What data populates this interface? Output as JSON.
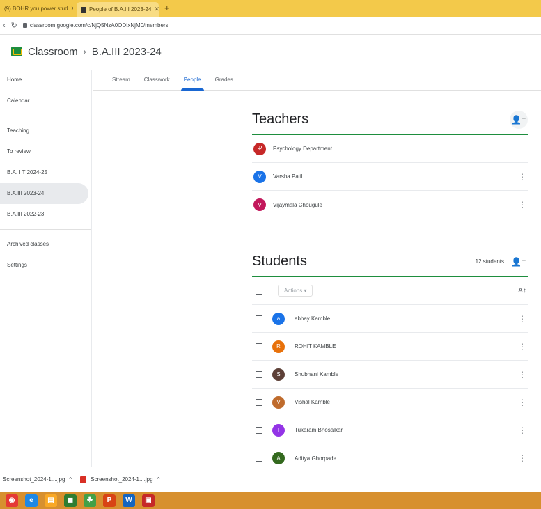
{
  "browser": {
    "tabs": [
      {
        "label": "(9) BOHR you power stud"
      },
      {
        "label": "People of B.A.III 2023-24"
      }
    ],
    "url": "classroom.google.com/c/NjQ5NzA0ODIxNjM0/members"
  },
  "header": {
    "app_title": "Classroom",
    "separator": "›",
    "class_title": "B.A.III 2023-24"
  },
  "sidebar": {
    "items": [
      {
        "label": "Home"
      },
      {
        "label": "Calendar"
      },
      {
        "label": "Teaching"
      },
      {
        "label": "To review"
      },
      {
        "label": "B.A. I T 2024-25"
      },
      {
        "label": "B.A.III 2023-24"
      },
      {
        "label": "B.A.III 2022-23"
      },
      {
        "label": "Archived classes"
      },
      {
        "label": "Settings"
      }
    ]
  },
  "class_tabs": [
    {
      "label": "Stream"
    },
    {
      "label": "Classwork"
    },
    {
      "label": "People"
    },
    {
      "label": "Grades"
    }
  ],
  "teachers": {
    "title": "Teachers",
    "list": [
      {
        "initial": "Ψ",
        "name": "Psychology Department",
        "color": "#c62828"
      },
      {
        "initial": "V",
        "name": "Varsha Patil",
        "color": "#1a73e8"
      },
      {
        "initial": "V",
        "name": "Vijaymala Chougule",
        "color": "#c2185b"
      }
    ]
  },
  "students": {
    "title": "Students",
    "count_label": "12 students",
    "actions_label": "Actions ▾",
    "list": [
      {
        "initial": "a",
        "name": "abhay Kamble",
        "color": "#1a73e8"
      },
      {
        "initial": "R",
        "name": "ROHIT KAMBLE",
        "color": "#e8710a"
      },
      {
        "initial": "S",
        "name": "Shubhani Kamble",
        "color": "#5d4037"
      },
      {
        "initial": "V",
        "name": "Vishal Kamble",
        "color": "#bf6b2c"
      },
      {
        "initial": "T",
        "name": "Tukaram Bhosalkar",
        "color": "#9334e6"
      },
      {
        "initial": "A",
        "name": "Aditya Ghorpade",
        "color": "#33691e"
      }
    ]
  },
  "downloads": [
    {
      "label": "Screenshot_2024-1....jpg"
    },
    {
      "label": "Screenshot_2024-1....jpg"
    }
  ],
  "taskbar": [
    {
      "glyph": "◉",
      "color": "#e53935"
    },
    {
      "glyph": "e",
      "color": "#1e88e5"
    },
    {
      "glyph": "▤",
      "color": "#f9a825"
    },
    {
      "glyph": "◼",
      "color": "#2e7d32"
    },
    {
      "glyph": "☘",
      "color": "#43a047"
    },
    {
      "glyph": "P",
      "color": "#d84315"
    },
    {
      "glyph": "W",
      "color": "#1565c0"
    },
    {
      "glyph": "▣",
      "color": "#c62828"
    }
  ]
}
